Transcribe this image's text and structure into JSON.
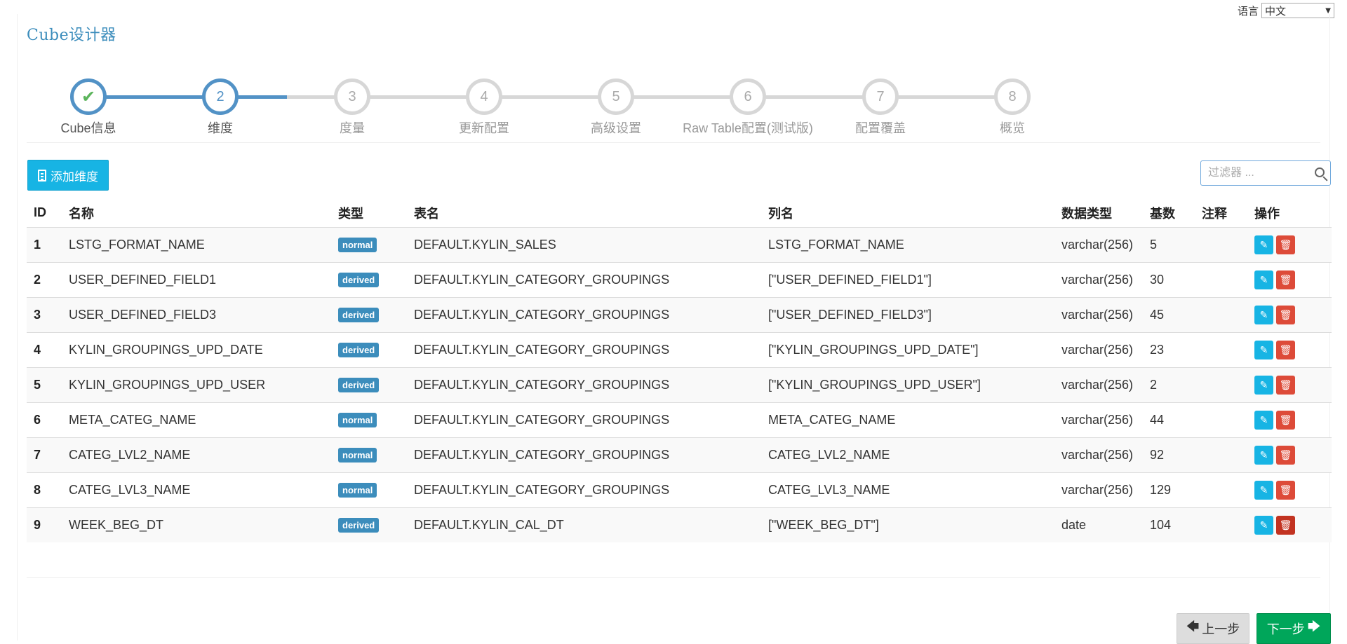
{
  "language": {
    "label": "语言",
    "selected": "中文"
  },
  "title": "Cube设计器",
  "wizard": {
    "steps": [
      {
        "label": "Cube信息",
        "marker": "✔"
      },
      {
        "label": "维度",
        "marker": "2"
      },
      {
        "label": "度量",
        "marker": "3"
      },
      {
        "label": "更新配置",
        "marker": "4"
      },
      {
        "label": "高级设置",
        "marker": "5"
      },
      {
        "label": "Raw Table配置(测试版)",
        "marker": "6"
      },
      {
        "label": "配置覆盖",
        "marker": "7"
      },
      {
        "label": "概览",
        "marker": "8"
      }
    ],
    "current_step": 2
  },
  "toolbar": {
    "add_label": "添加维度",
    "filter_placeholder": "过滤器 ..."
  },
  "table": {
    "headers": [
      "ID",
      "名称",
      "类型",
      "表名",
      "列名",
      "数据类型",
      "基数",
      "注释",
      "操作"
    ],
    "rows": [
      {
        "id": "1",
        "name": "LSTG_FORMAT_NAME",
        "type": "normal",
        "table": "DEFAULT.KYLIN_SALES",
        "column": "LSTG_FORMAT_NAME",
        "datatype": "varchar(256)",
        "cardinality": "5",
        "comment": ""
      },
      {
        "id": "2",
        "name": "USER_DEFINED_FIELD1",
        "type": "derived",
        "table": "DEFAULT.KYLIN_CATEGORY_GROUPINGS",
        "column": "[\"USER_DEFINED_FIELD1\"]",
        "datatype": "varchar(256)",
        "cardinality": "30",
        "comment": ""
      },
      {
        "id": "3",
        "name": "USER_DEFINED_FIELD3",
        "type": "derived",
        "table": "DEFAULT.KYLIN_CATEGORY_GROUPINGS",
        "column": "[\"USER_DEFINED_FIELD3\"]",
        "datatype": "varchar(256)",
        "cardinality": "45",
        "comment": ""
      },
      {
        "id": "4",
        "name": "KYLIN_GROUPINGS_UPD_DATE",
        "type": "derived",
        "table": "DEFAULT.KYLIN_CATEGORY_GROUPINGS",
        "column": "[\"KYLIN_GROUPINGS_UPD_DATE\"]",
        "datatype": "varchar(256)",
        "cardinality": "23",
        "comment": ""
      },
      {
        "id": "5",
        "name": "KYLIN_GROUPINGS_UPD_USER",
        "type": "derived",
        "table": "DEFAULT.KYLIN_CATEGORY_GROUPINGS",
        "column": "[\"KYLIN_GROUPINGS_UPD_USER\"]",
        "datatype": "varchar(256)",
        "cardinality": "2",
        "comment": ""
      },
      {
        "id": "6",
        "name": "META_CATEG_NAME",
        "type": "normal",
        "table": "DEFAULT.KYLIN_CATEGORY_GROUPINGS",
        "column": "META_CATEG_NAME",
        "datatype": "varchar(256)",
        "cardinality": "44",
        "comment": ""
      },
      {
        "id": "7",
        "name": "CATEG_LVL2_NAME",
        "type": "normal",
        "table": "DEFAULT.KYLIN_CATEGORY_GROUPINGS",
        "column": "CATEG_LVL2_NAME",
        "datatype": "varchar(256)",
        "cardinality": "92",
        "comment": ""
      },
      {
        "id": "8",
        "name": "CATEG_LVL3_NAME",
        "type": "normal",
        "table": "DEFAULT.KYLIN_CATEGORY_GROUPINGS",
        "column": "CATEG_LVL3_NAME",
        "datatype": "varchar(256)",
        "cardinality": "129",
        "comment": ""
      },
      {
        "id": "9",
        "name": "WEEK_BEG_DT",
        "type": "derived",
        "table": "DEFAULT.KYLIN_CAL_DT",
        "column": "[\"WEEK_BEG_DT\"]",
        "datatype": "date",
        "cardinality": "104",
        "comment": ""
      }
    ]
  },
  "nav": {
    "prev_label": "上一步",
    "next_label": "下一步"
  },
  "colors": {
    "primary": "#3c8dbc",
    "info": "#17b4e4",
    "danger": "#dd4b39",
    "success": "#00a65a",
    "step_done": "#5292c6",
    "check": "#5bb45b"
  }
}
